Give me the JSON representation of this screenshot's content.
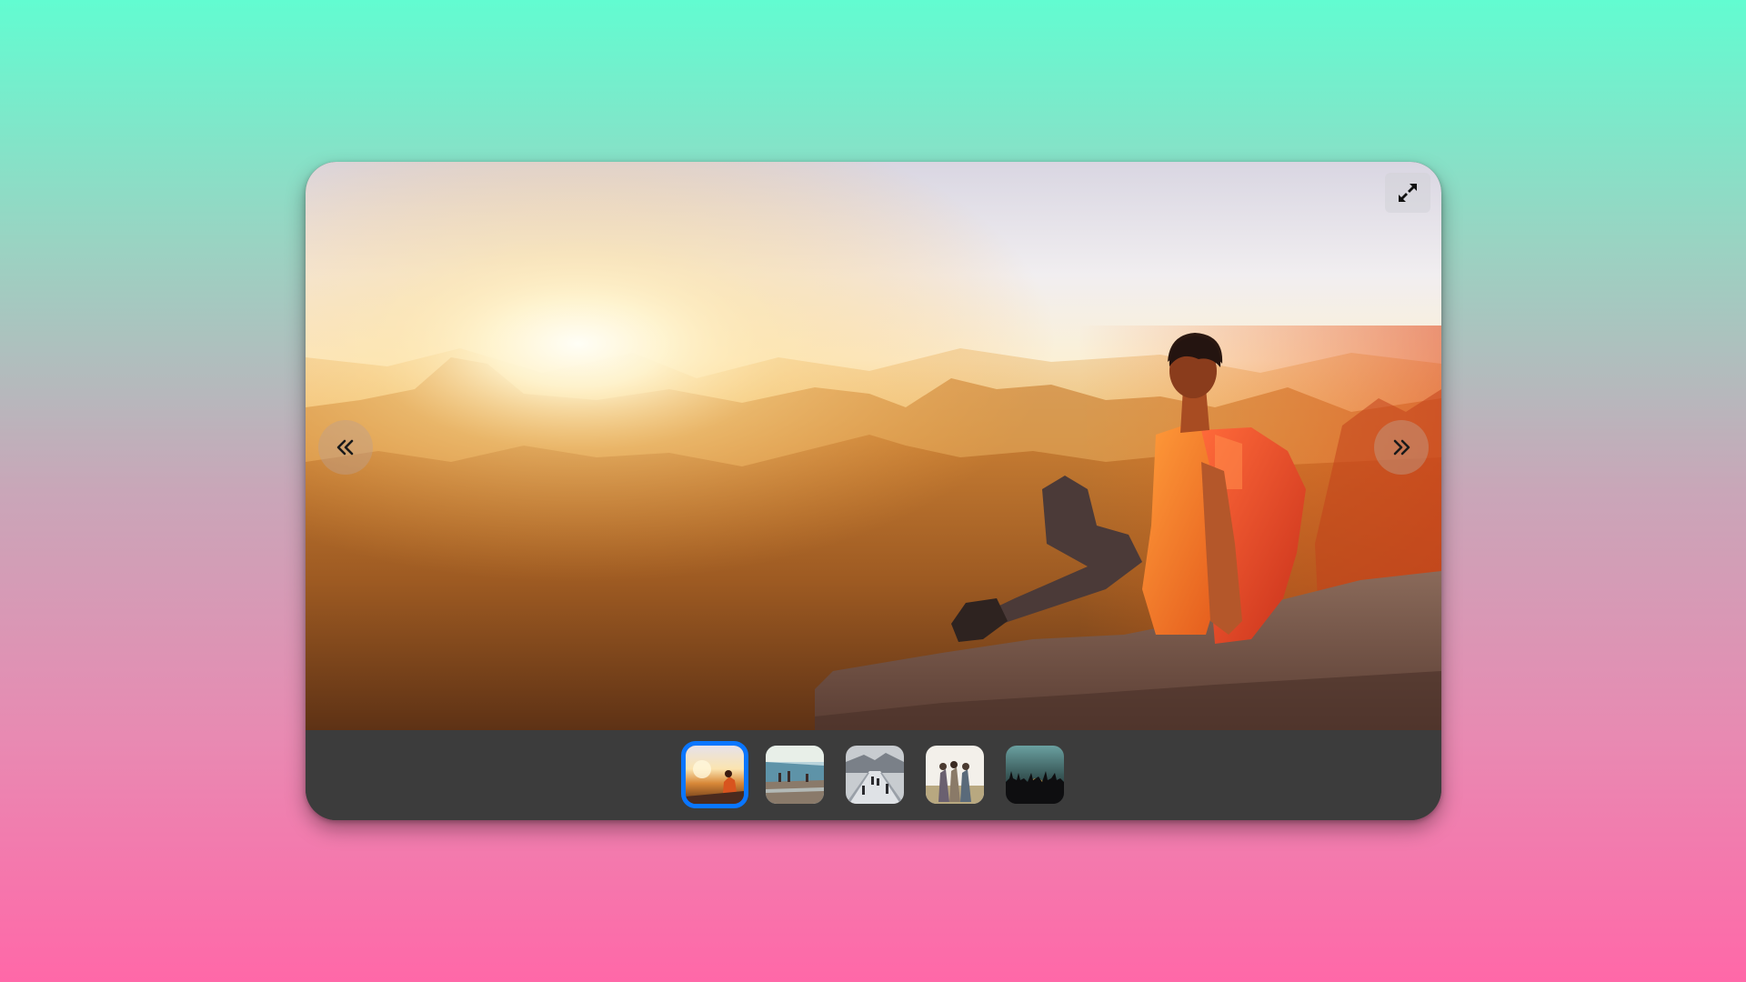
{
  "gallery": {
    "active_index": 0,
    "slide_count": 5,
    "thumbnails": [
      {
        "scene": "sunset-hiker",
        "selected": true
      },
      {
        "scene": "lake-people",
        "selected": false
      },
      {
        "scene": "bridge-walkers",
        "selected": false
      },
      {
        "scene": "friends-group",
        "selected": false
      },
      {
        "scene": "concert-crowd",
        "selected": false
      }
    ],
    "controls": {
      "prev_icon": "chevrons-left-icon",
      "next_icon": "chevrons-right-icon",
      "fullscreen_icon": "expand-icon"
    },
    "colors": {
      "active_thumb_border": "#0a76ff",
      "thumb_bar_background": "#3c3c3c",
      "page_gradient_top": "#62fcd1",
      "page_gradient_bottom": "#ff68a8"
    }
  }
}
